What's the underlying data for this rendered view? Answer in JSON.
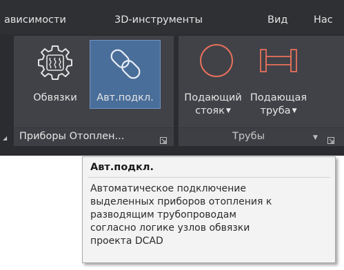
{
  "ribbon_tabs": [
    {
      "label": "ависимости"
    },
    {
      "label": "3D-инструменты"
    },
    {
      "label": "Вид"
    },
    {
      "label": "Нас"
    }
  ],
  "panels": {
    "heating": {
      "title": "Приборы Отоплен...",
      "buttons": {
        "bindings": {
          "label": "Обвязки",
          "icon": "heater-gear-icon"
        },
        "auto_connect": {
          "label": "Авт.подкл.",
          "icon": "link-chain-icon",
          "active": true
        }
      }
    },
    "pipes": {
      "title": "Трубы",
      "buttons": {
        "riser": {
          "label_line1": "Подающий",
          "label_line2": "стояк",
          "icon": "riser-circle-icon"
        },
        "pipe": {
          "label_line1": "Подающая",
          "label_line2": "труба",
          "icon": "pipe-segment-icon"
        }
      }
    }
  },
  "tooltip": {
    "title": "Авт.подкл.",
    "lines": [
      "Автоматическое подключение",
      "выделенных приборов отопления к",
      "разводящим трубопроводам",
      "согласно логике узлов обвязки",
      "проекта DCAD"
    ]
  },
  "colors": {
    "ribbon_background": "#2f3033",
    "panel_background": "#404247",
    "active_button": "#4a6e9a",
    "pipe_icon_red": "#e8705c",
    "tooltip_background": "#f3f3f3"
  }
}
